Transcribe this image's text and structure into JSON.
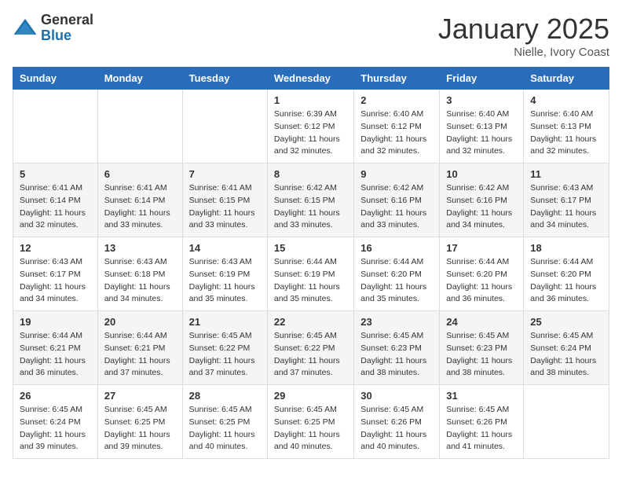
{
  "header": {
    "logo_general": "General",
    "logo_blue": "Blue",
    "month_title": "January 2025",
    "subtitle": "Nielle, Ivory Coast"
  },
  "days_of_week": [
    "Sunday",
    "Monday",
    "Tuesday",
    "Wednesday",
    "Thursday",
    "Friday",
    "Saturday"
  ],
  "weeks": [
    [
      {
        "day": "",
        "info": ""
      },
      {
        "day": "",
        "info": ""
      },
      {
        "day": "",
        "info": ""
      },
      {
        "day": "1",
        "info": "Sunrise: 6:39 AM\nSunset: 6:12 PM\nDaylight: 11 hours and 32 minutes."
      },
      {
        "day": "2",
        "info": "Sunrise: 6:40 AM\nSunset: 6:12 PM\nDaylight: 11 hours and 32 minutes."
      },
      {
        "day": "3",
        "info": "Sunrise: 6:40 AM\nSunset: 6:13 PM\nDaylight: 11 hours and 32 minutes."
      },
      {
        "day": "4",
        "info": "Sunrise: 6:40 AM\nSunset: 6:13 PM\nDaylight: 11 hours and 32 minutes."
      }
    ],
    [
      {
        "day": "5",
        "info": "Sunrise: 6:41 AM\nSunset: 6:14 PM\nDaylight: 11 hours and 32 minutes."
      },
      {
        "day": "6",
        "info": "Sunrise: 6:41 AM\nSunset: 6:14 PM\nDaylight: 11 hours and 33 minutes."
      },
      {
        "day": "7",
        "info": "Sunrise: 6:41 AM\nSunset: 6:15 PM\nDaylight: 11 hours and 33 minutes."
      },
      {
        "day": "8",
        "info": "Sunrise: 6:42 AM\nSunset: 6:15 PM\nDaylight: 11 hours and 33 minutes."
      },
      {
        "day": "9",
        "info": "Sunrise: 6:42 AM\nSunset: 6:16 PM\nDaylight: 11 hours and 33 minutes."
      },
      {
        "day": "10",
        "info": "Sunrise: 6:42 AM\nSunset: 6:16 PM\nDaylight: 11 hours and 34 minutes."
      },
      {
        "day": "11",
        "info": "Sunrise: 6:43 AM\nSunset: 6:17 PM\nDaylight: 11 hours and 34 minutes."
      }
    ],
    [
      {
        "day": "12",
        "info": "Sunrise: 6:43 AM\nSunset: 6:17 PM\nDaylight: 11 hours and 34 minutes."
      },
      {
        "day": "13",
        "info": "Sunrise: 6:43 AM\nSunset: 6:18 PM\nDaylight: 11 hours and 34 minutes."
      },
      {
        "day": "14",
        "info": "Sunrise: 6:43 AM\nSunset: 6:19 PM\nDaylight: 11 hours and 35 minutes."
      },
      {
        "day": "15",
        "info": "Sunrise: 6:44 AM\nSunset: 6:19 PM\nDaylight: 11 hours and 35 minutes."
      },
      {
        "day": "16",
        "info": "Sunrise: 6:44 AM\nSunset: 6:20 PM\nDaylight: 11 hours and 35 minutes."
      },
      {
        "day": "17",
        "info": "Sunrise: 6:44 AM\nSunset: 6:20 PM\nDaylight: 11 hours and 36 minutes."
      },
      {
        "day": "18",
        "info": "Sunrise: 6:44 AM\nSunset: 6:20 PM\nDaylight: 11 hours and 36 minutes."
      }
    ],
    [
      {
        "day": "19",
        "info": "Sunrise: 6:44 AM\nSunset: 6:21 PM\nDaylight: 11 hours and 36 minutes."
      },
      {
        "day": "20",
        "info": "Sunrise: 6:44 AM\nSunset: 6:21 PM\nDaylight: 11 hours and 37 minutes."
      },
      {
        "day": "21",
        "info": "Sunrise: 6:45 AM\nSunset: 6:22 PM\nDaylight: 11 hours and 37 minutes."
      },
      {
        "day": "22",
        "info": "Sunrise: 6:45 AM\nSunset: 6:22 PM\nDaylight: 11 hours and 37 minutes."
      },
      {
        "day": "23",
        "info": "Sunrise: 6:45 AM\nSunset: 6:23 PM\nDaylight: 11 hours and 38 minutes."
      },
      {
        "day": "24",
        "info": "Sunrise: 6:45 AM\nSunset: 6:23 PM\nDaylight: 11 hours and 38 minutes."
      },
      {
        "day": "25",
        "info": "Sunrise: 6:45 AM\nSunset: 6:24 PM\nDaylight: 11 hours and 38 minutes."
      }
    ],
    [
      {
        "day": "26",
        "info": "Sunrise: 6:45 AM\nSunset: 6:24 PM\nDaylight: 11 hours and 39 minutes."
      },
      {
        "day": "27",
        "info": "Sunrise: 6:45 AM\nSunset: 6:25 PM\nDaylight: 11 hours and 39 minutes."
      },
      {
        "day": "28",
        "info": "Sunrise: 6:45 AM\nSunset: 6:25 PM\nDaylight: 11 hours and 40 minutes."
      },
      {
        "day": "29",
        "info": "Sunrise: 6:45 AM\nSunset: 6:25 PM\nDaylight: 11 hours and 40 minutes."
      },
      {
        "day": "30",
        "info": "Sunrise: 6:45 AM\nSunset: 6:26 PM\nDaylight: 11 hours and 40 minutes."
      },
      {
        "day": "31",
        "info": "Sunrise: 6:45 AM\nSunset: 6:26 PM\nDaylight: 11 hours and 41 minutes."
      },
      {
        "day": "",
        "info": ""
      }
    ]
  ]
}
